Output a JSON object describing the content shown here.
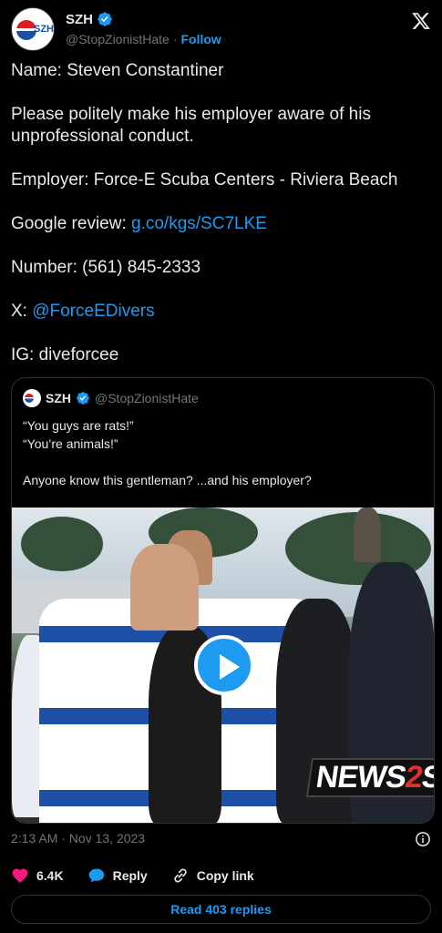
{
  "author": {
    "display_name": "SZH",
    "handle": "@StopZionistHate",
    "separator": "·",
    "follow_label": "Follow",
    "avatar_text": "SZH"
  },
  "post": {
    "lines": [
      "Name: Steven Constantiner",
      "Please politely make his employer aware of his unprofessional conduct.",
      "Employer: Force-E Scuba Centers - Riviera Beach"
    ],
    "review_prefix": "Google review: ",
    "review_link": "g.co/kgs/SC7LKE",
    "number": "Number: (561) 845-2333",
    "x_prefix": "X: ",
    "x_link": "@ForceEDivers",
    "ig": "IG: diveforcee"
  },
  "quoted": {
    "display_name": "SZH",
    "handle": "@StopZionistHate",
    "line1": "“You guys are rats!”",
    "line2": "“You’re animals!”",
    "line3": "Anyone know this gentleman? ...and his employer?",
    "watermark_a": "NEWS",
    "watermark_b": "2",
    "watermark_c": "SI"
  },
  "meta": {
    "timestamp": "2:13 AM · Nov 13, 2023"
  },
  "actions": {
    "likes": "6.4K",
    "reply_label": "Reply",
    "copy_label": "Copy link"
  },
  "read_replies_label": "Read 403 replies",
  "colors": {
    "accent": "#1d9bf0",
    "like": "#f91880",
    "muted": "#71767b",
    "border": "#2f3336"
  }
}
